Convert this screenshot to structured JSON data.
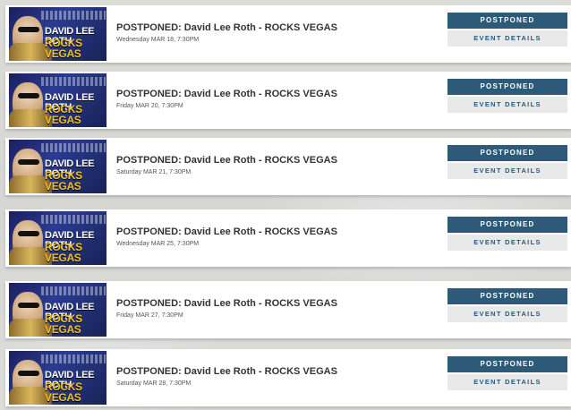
{
  "events": [
    {
      "image_alt_top": "DAVID LEE ROTH",
      "image_alt_bottom": "ROCKS VEGAS",
      "title": "POSTPONED: David Lee Roth - ROCKS VEGAS",
      "date": "Wednesday MAR 18, 7:30PM",
      "status_label": "POSTPONED",
      "details_label": "EVENT DETAILS"
    },
    {
      "image_alt_top": "DAVID LEE ROTH",
      "image_alt_bottom": "ROCKS VEGAS",
      "title": "POSTPONED: David Lee Roth - ROCKS VEGAS",
      "date": "Friday MAR 20, 7:30PM",
      "status_label": "POSTPONED",
      "details_label": "EVENT DETAILS"
    },
    {
      "image_alt_top": "DAVID LEE ROTH",
      "image_alt_bottom": "ROCKS VEGAS",
      "title": "POSTPONED: David Lee Roth - ROCKS VEGAS",
      "date": "Saturday MAR 21, 7:30PM",
      "status_label": "POSTPONED",
      "details_label": "EVENT DETAILS"
    },
    {
      "image_alt_top": "DAVID LEE ROTH",
      "image_alt_bottom": "ROCKS VEGAS",
      "title": "POSTPONED: David Lee Roth - ROCKS VEGAS",
      "date": "Wednesday MAR 25, 7:30PM",
      "status_label": "POSTPONED",
      "details_label": "EVENT DETAILS"
    },
    {
      "image_alt_top": "DAVID LEE ROTH",
      "image_alt_bottom": "ROCKS VEGAS",
      "title": "POSTPONED: David Lee Roth - ROCKS VEGAS",
      "date": "Friday MAR 27, 7:30PM",
      "status_label": "POSTPONED",
      "details_label": "EVENT DETAILS"
    },
    {
      "image_alt_top": "DAVID LEE ROTH",
      "image_alt_bottom": "ROCKS VEGAS",
      "title": "POSTPONED: David Lee Roth - ROCKS VEGAS",
      "date": "Saturday MAR 28, 7:30PM",
      "status_label": "POSTPONED",
      "details_label": "EVENT DETAILS"
    }
  ],
  "colors": {
    "status_button": "#2c5a78",
    "details_button_bg": "#e9e9e9",
    "title_text": "#333333"
  }
}
